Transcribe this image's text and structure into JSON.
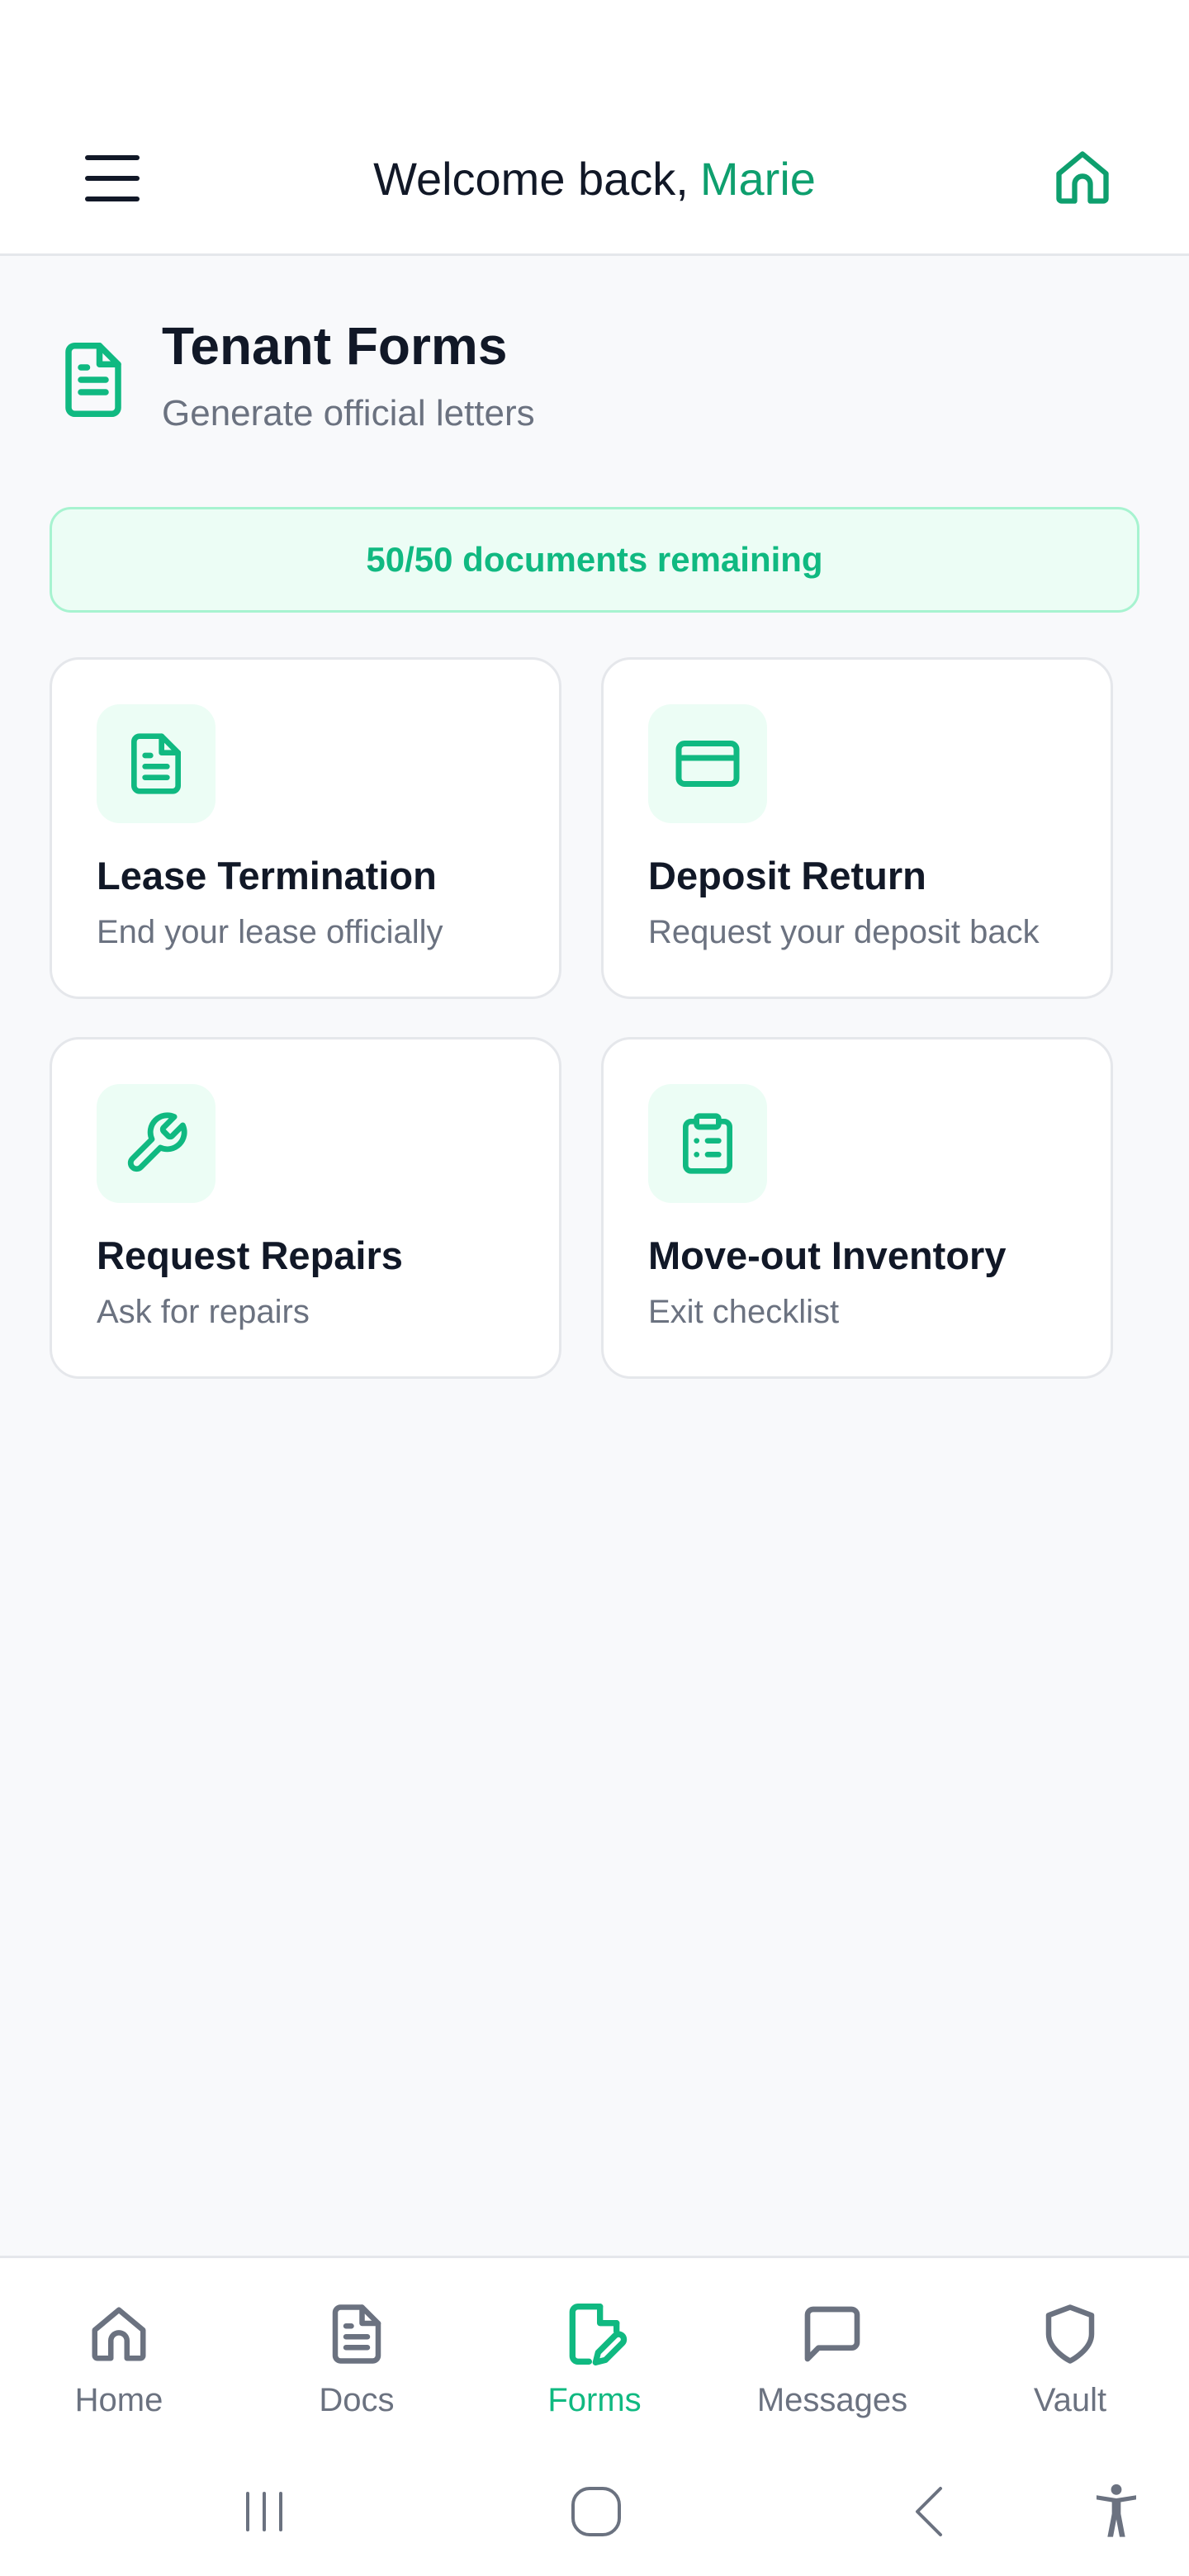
{
  "header": {
    "greeting": "Welcome back,",
    "user_name": "Marie",
    "menu_icon": "hamburger-menu-icon",
    "home_icon": "house-icon"
  },
  "page": {
    "icon": "document-icon",
    "title": "Tenant Forms",
    "subtitle": "Generate official letters"
  },
  "quota": {
    "text": "50/50 documents remaining",
    "used": 50,
    "total": 50
  },
  "cards": [
    {
      "title": "Lease Termination",
      "subtitle": "End your lease officially",
      "icon": "document-icon"
    },
    {
      "title": "Deposit Return",
      "subtitle": "Request your deposit back",
      "icon": "credit-card-icon"
    },
    {
      "title": "Request Repairs",
      "subtitle": "Ask for repairs",
      "icon": "wrench-icon"
    },
    {
      "title": "Move-out Inventory",
      "subtitle": "Exit checklist",
      "icon": "clipboard-list-icon"
    }
  ],
  "bottom_nav": {
    "active": "Forms",
    "items": [
      {
        "label": "Home",
        "icon": "house-icon"
      },
      {
        "label": "Docs",
        "icon": "document-icon"
      },
      {
        "label": "Forms",
        "icon": "document-edit-icon"
      },
      {
        "label": "Messages",
        "icon": "chat-bubble-icon"
      },
      {
        "label": "Vault",
        "icon": "shield-icon"
      }
    ]
  },
  "system_nav": {
    "icons": [
      "recent-apps-icon",
      "home-circle-icon",
      "back-icon",
      "accessibility-icon"
    ]
  },
  "colors": {
    "accent": "#10b981",
    "accent_dark": "#0e9f6e",
    "accent_bg": "#ecfdf5",
    "accent_border": "#a7f3d0",
    "text": "#111827",
    "muted": "#6b7280",
    "background": "#f8f9fb"
  }
}
